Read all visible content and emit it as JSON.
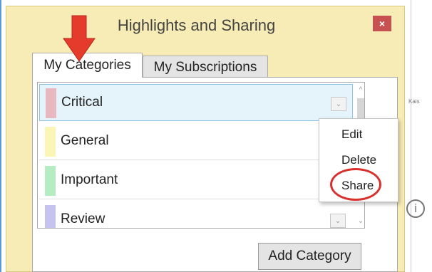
{
  "window": {
    "title": "Highlights and Sharing",
    "close_glyph": "×"
  },
  "tabs": [
    {
      "label": "My Categories",
      "active": true
    },
    {
      "label": "My Subscriptions",
      "active": false
    }
  ],
  "categories": [
    {
      "label": "Critical",
      "color": "#e8b8c0",
      "selected": true
    },
    {
      "label": "General",
      "color": "#fcf6b6",
      "selected": false
    },
    {
      "label": "Important",
      "color": "#b6ecc2",
      "selected": false
    },
    {
      "label": "Review",
      "color": "#c6c4ef",
      "selected": false
    }
  ],
  "row_dropdown_glyph": "⌄",
  "scrollbar": {
    "up_glyph": "^",
    "down_glyph": "⌄"
  },
  "context_menu": {
    "items": [
      "Edit",
      "Delete",
      "Share"
    ],
    "highlighted": "Share"
  },
  "add_category_label": "Add Category",
  "background": {
    "text": "Kais",
    "info_glyph": "i"
  },
  "colors": {
    "annotation_red": "#d9302c",
    "window_bg": "#f7ecb5",
    "close_red": "#c75050"
  }
}
